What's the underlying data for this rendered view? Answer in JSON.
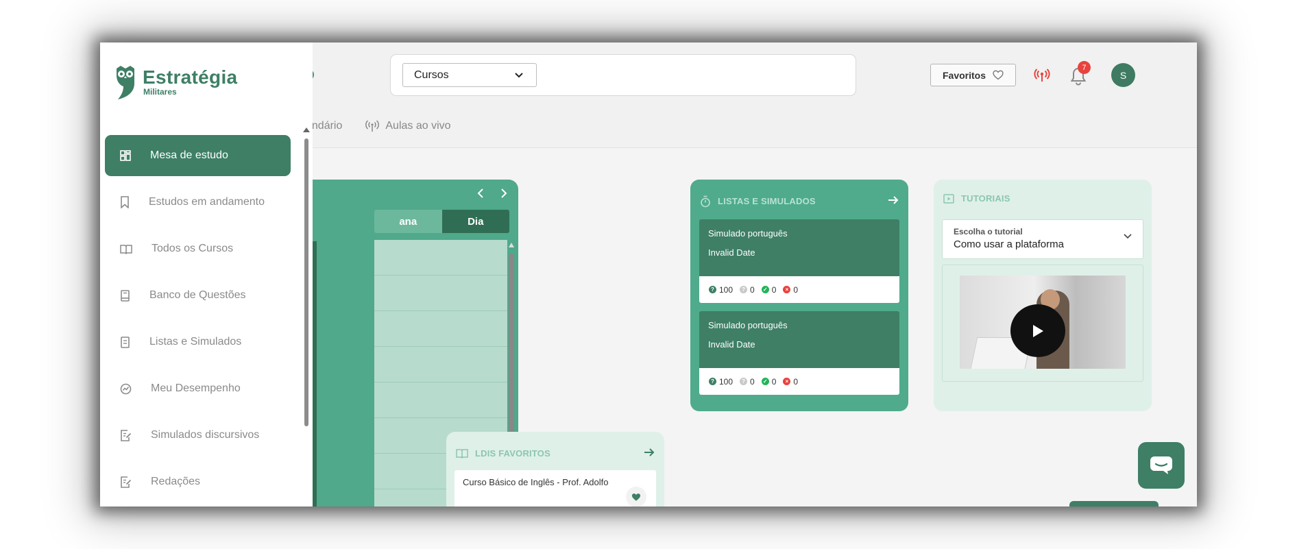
{
  "colors": {
    "brand_green": "#3e7f66",
    "card_green": "#4fab8b",
    "light_card": "#dff0e9",
    "badge_red": "#e9423c"
  },
  "sidebar": {
    "logo": {
      "title": "Estratégia",
      "subtitle": "Militares"
    },
    "items": [
      {
        "label": "Mesa de estudo",
        "icon": "dashboard-icon",
        "active": true
      },
      {
        "label": "Estudos em andamento",
        "icon": "bookmark-icon"
      },
      {
        "label": "Todos os Cursos",
        "icon": "book-open-icon"
      },
      {
        "label": "Banco de Questões",
        "icon": "book-icon"
      },
      {
        "label": "Listas e Simulados",
        "icon": "list-doc-icon"
      },
      {
        "label": "Meu Desempenho",
        "icon": "chart-circle-icon"
      },
      {
        "label": "Simulados discursivos",
        "icon": "edit-doc-icon"
      },
      {
        "label": "Redações",
        "icon": "edit-doc-icon"
      }
    ]
  },
  "header": {
    "search": {
      "select_value": "Cursos"
    },
    "favorites_label": "Favoritos",
    "notifications_count": "7",
    "avatar_initial": "S",
    "nav_tabs": [
      {
        "label": "endário",
        "icon": "calendar-icon"
      },
      {
        "label": "Aulas ao vivo",
        "icon": "broadcast-icon"
      }
    ]
  },
  "calendar": {
    "segments": {
      "week": "ana",
      "day": "Dia"
    }
  },
  "listas": {
    "title": "LISTAS E SIMULADOS",
    "items": [
      {
        "name": "Simulado português",
        "date": "Invalid Date",
        "total": "100",
        "unanswered": "0",
        "correct": "0",
        "wrong": "0"
      },
      {
        "name": "Simulado português",
        "date": "Invalid Date",
        "total": "100",
        "unanswered": "0",
        "correct": "0",
        "wrong": "0"
      }
    ]
  },
  "tutoriais": {
    "title": "TUTORIAIS",
    "select_label": "Escolha o tutorial",
    "select_value": "Como usar a plataforma"
  },
  "ldis": {
    "title": "LDIS FAVORITOS",
    "item": "Curso Básico de Inglês - Prof. Adolfo"
  }
}
